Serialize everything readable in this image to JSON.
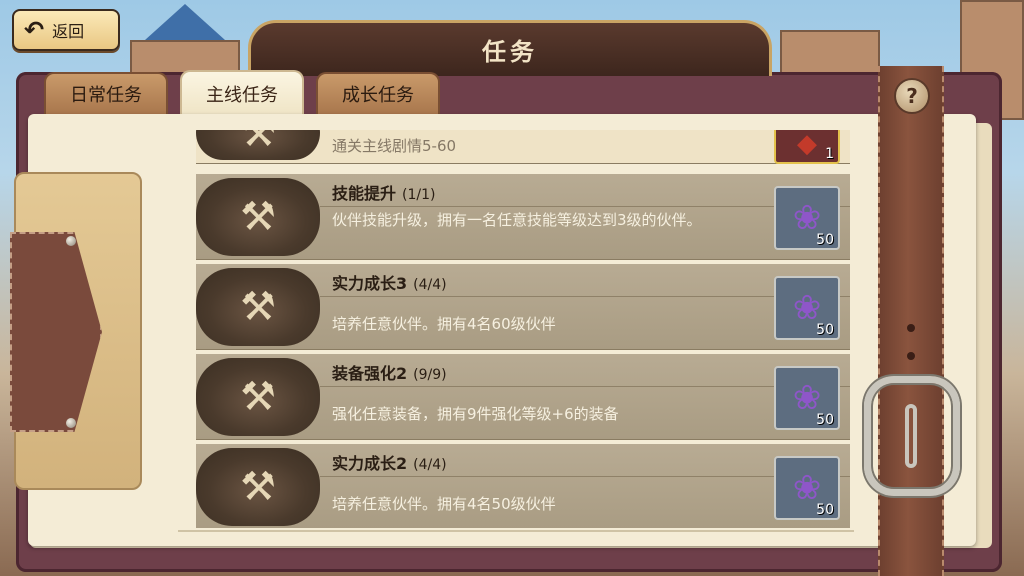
{
  "header": {
    "back_label": "返回",
    "title": "任务"
  },
  "tabs": [
    {
      "label": "日常任务",
      "active": false
    },
    {
      "label": "主线任务",
      "active": true
    },
    {
      "label": "成长任务",
      "active": false
    }
  ],
  "quests": [
    {
      "name": "",
      "progress": "",
      "description": "通关主线剧情5-60",
      "reward_count": "1",
      "reward_icon": "red-crystal-icon",
      "partial": true,
      "icon": "flaming-sword-icon"
    },
    {
      "name": "技能提升",
      "progress": "(1/1)",
      "description": "伙伴技能升级，拥有一名任意技能等级达到3级的伙伴。",
      "reward_count": "50",
      "reward_icon": "purple-flower-icon",
      "icon": "anvil-hammer-icon"
    },
    {
      "name": "实力成长3",
      "progress": "(4/4)",
      "description": "培养任意伙伴。拥有4名60级伙伴",
      "reward_count": "50",
      "reward_icon": "purple-flower-icon",
      "icon": "anvil-hammer-icon"
    },
    {
      "name": "装备强化2",
      "progress": "(9/9)",
      "description": "强化任意装备，拥有9件强化等级+6的装备",
      "reward_count": "50",
      "reward_icon": "purple-flower-icon",
      "icon": "anvil-hammer-icon"
    },
    {
      "name": "实力成长2",
      "progress": "(4/4)",
      "description": "培养任意伙伴。拥有4名50级伙伴",
      "reward_count": "50",
      "reward_icon": "purple-flower-icon",
      "icon": "anvil-hammer-icon"
    }
  ],
  "help": {
    "symbol": "?"
  },
  "icons": {
    "back": "↶",
    "anvil": "⚒",
    "gem": "❀",
    "crystal": "◆"
  },
  "colors": {
    "frame": "#6e3f4a",
    "paper": "#f4ecd6",
    "row": "#b8ab93",
    "reward_bg": "#5d6d80"
  }
}
